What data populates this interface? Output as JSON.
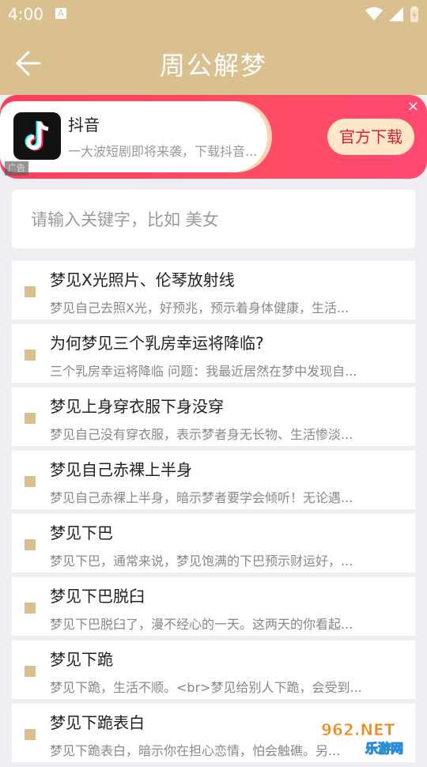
{
  "status": {
    "time": "4:00",
    "notif_icon": "A"
  },
  "header": {
    "title": "周公解梦",
    "back_icon": "arrow-left-icon"
  },
  "ad": {
    "app_name": "抖音",
    "desc": "一大波短剧即将来袭，下载抖音...",
    "button": "官方下载",
    "close": "×",
    "tag": "广告"
  },
  "search": {
    "placeholder": "请输入关键字，比如 美女",
    "value": ""
  },
  "items": [
    {
      "title": "梦见X光照片、伦琴放射线",
      "desc": "梦见自己去照X光，好预兆，预示着身体健康，生活..."
    },
    {
      "title": "为何梦见三个乳房幸运将降临?",
      "desc": "三个乳房幸运将降临 问题：我最近居然在梦中发现自..."
    },
    {
      "title": "梦见上身穿衣服下身没穿",
      "desc": "梦见自己没有穿衣服，表示梦者身无长物、生活惨淡..."
    },
    {
      "title": "梦见自己赤裸上半身",
      "desc": "梦见自己赤裸上半身，暗示梦者要学会倾听！无论遇..."
    },
    {
      "title": "梦见下巴",
      "desc": "梦见下巴，通常来说，梦见饱满的下巴预示财运好，..."
    },
    {
      "title": "梦见下巴脱臼",
      "desc": "梦见下巴脱臼了，漫不经心的一天。这两天的你看起..."
    },
    {
      "title": "梦见下跪",
      "desc": "梦见下跪，生活不顺。<br>梦见给别人下跪，会受到..."
    },
    {
      "title": "梦见下跪表白",
      "desc": "梦见下跪表白，暗示你在担心恋情，怕会触礁。另..."
    }
  ],
  "watermark": {
    "top": "962.NET",
    "bottom": "乐游网"
  },
  "colors": {
    "accent": "#d9c08e",
    "ad_red": "#ff3d5e"
  }
}
